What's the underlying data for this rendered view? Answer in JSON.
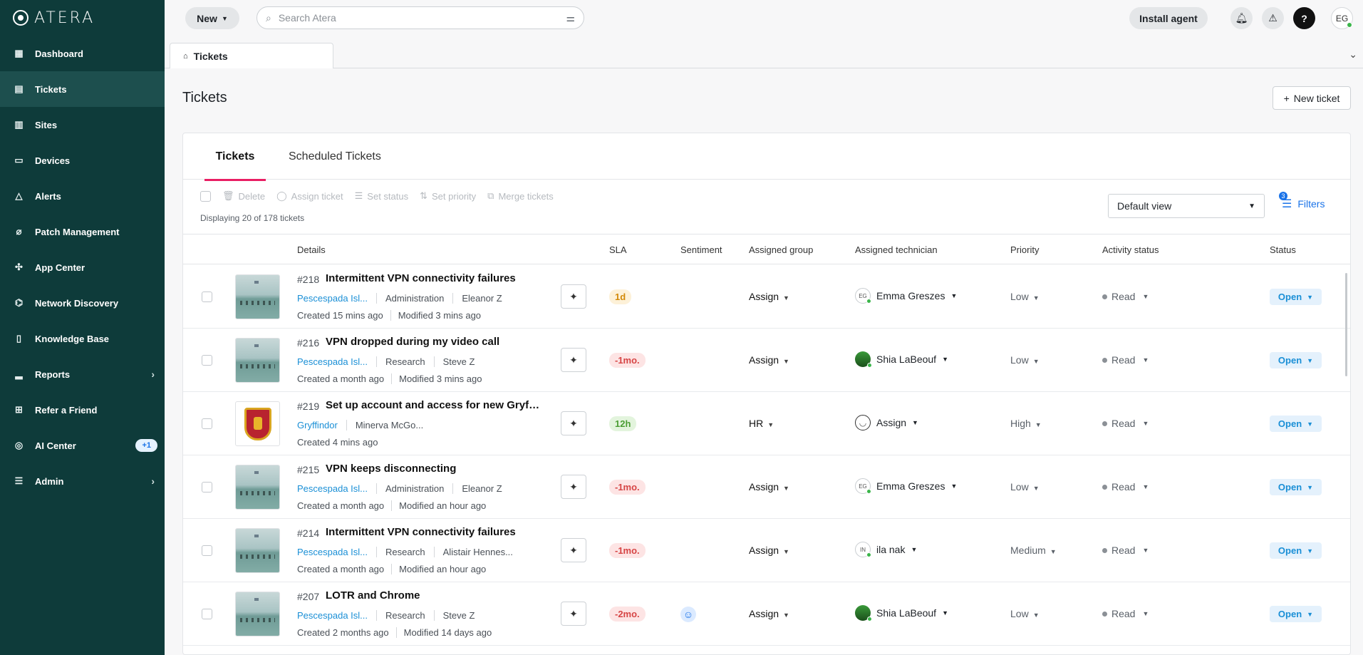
{
  "app": {
    "brand": "ATERA"
  },
  "sidebar": {
    "items": [
      {
        "label": "Dashboard",
        "icon": "dashboard-icon"
      },
      {
        "label": "Tickets",
        "icon": "tickets-icon",
        "active": true
      },
      {
        "label": "Sites",
        "icon": "building-icon"
      },
      {
        "label": "Devices",
        "icon": "monitor-icon"
      },
      {
        "label": "Alerts",
        "icon": "warning-icon"
      },
      {
        "label": "Patch Management",
        "icon": "patch-icon"
      },
      {
        "label": "App Center",
        "icon": "puzzle-icon"
      },
      {
        "label": "Network Discovery",
        "icon": "network-icon"
      },
      {
        "label": "Knowledge Base",
        "icon": "book-icon"
      },
      {
        "label": "Reports",
        "icon": "chart-icon",
        "expandable": true
      },
      {
        "label": "Refer a Friend",
        "icon": "gift-icon"
      },
      {
        "label": "AI Center",
        "icon": "ai-icon",
        "badge": "+1"
      },
      {
        "label": "Admin",
        "icon": "sliders-icon",
        "expandable": true
      }
    ]
  },
  "topbar": {
    "new_label": "New",
    "search_placeholder": "Search Atera",
    "install_label": "Install agent",
    "help_label": "?",
    "user_initials": "EG"
  },
  "breadcrumb_tab": "Tickets",
  "page": {
    "title": "Tickets",
    "new_ticket_label": "New ticket",
    "tabs": [
      "Tickets",
      "Scheduled Tickets"
    ],
    "actions": [
      "Delete",
      "Assign ticket",
      "Set status",
      "Set priority",
      "Merge tickets"
    ],
    "count_text": "Displaying 20 of 178 tickets",
    "view": "Default view",
    "filters_label": "Filters",
    "filters_count": "3"
  },
  "columns": [
    "Details",
    "SLA",
    "Sentiment",
    "Assigned group",
    "Assigned technician",
    "Priority",
    "Activity status",
    "Status"
  ],
  "colors": {
    "sidebar_bg": "#0e3b3a",
    "accent": "#e91e63",
    "link": "#1a8fd6"
  },
  "tickets": [
    {
      "id": "#218",
      "title": "Intermittent VPN connectivity failures",
      "site": "Pescespada Isl...",
      "dept": "Administration",
      "contact": "Eleanor Z",
      "created": "Created 15 mins ago",
      "modified": "Modified 3 mins ago",
      "sla": "1d",
      "sentiment": "",
      "group": "Assign",
      "tech_initials": "EG",
      "tech": "Emma Greszes",
      "priority": "Low",
      "activity": "Read",
      "status": "Open"
    },
    {
      "id": "#216",
      "title": "VPN dropped during my video call",
      "site": "Pescespada Isl...",
      "dept": "Research",
      "contact": "Steve Z",
      "created": "Created a month ago",
      "modified": "Modified 3 mins ago",
      "sla": "-1mo.",
      "sentiment": "",
      "group": "Assign",
      "tech_initials": "",
      "tech": "Shia LaBeouf",
      "priority": "Low",
      "activity": "Read",
      "status": "Open"
    },
    {
      "id": "#219",
      "title": "Set up account and access for new Gryffi...",
      "site": "Gryffindor",
      "dept": "Minerva McGo...",
      "contact": "",
      "created": "Created 4 mins ago",
      "modified": "",
      "sla": "12h",
      "sentiment": "",
      "group": "HR",
      "tech_initials": "",
      "tech": "Assign",
      "priority": "High",
      "activity": "Read",
      "status": "Open"
    },
    {
      "id": "#215",
      "title": "VPN keeps disconnecting",
      "site": "Pescespada Isl...",
      "dept": "Administration",
      "contact": "Eleanor Z",
      "created": "Created a month ago",
      "modified": "Modified an hour ago",
      "sla": "-1mo.",
      "sentiment": "",
      "group": "Assign",
      "tech_initials": "EG",
      "tech": "Emma Greszes",
      "priority": "Low",
      "activity": "Read",
      "status": "Open"
    },
    {
      "id": "#214",
      "title": "Intermittent VPN connectivity failures",
      "site": "Pescespada Isl...",
      "dept": "Research",
      "contact": "Alistair Hennes...",
      "created": "Created a month ago",
      "modified": "Modified an hour ago",
      "sla": "-1mo.",
      "sentiment": "",
      "group": "Assign",
      "tech_initials": "IN",
      "tech": "ila nak",
      "priority": "Medium",
      "activity": "Read",
      "status": "Open"
    },
    {
      "id": "#207",
      "title": "LOTR and Chrome",
      "site": "Pescespada Isl...",
      "dept": "Research",
      "contact": "Steve Z",
      "created": "Created 2 months ago",
      "modified": "Modified 14 days ago",
      "sla": "-2mo.",
      "sentiment": "smiley-icon",
      "group": "Assign",
      "tech_initials": "",
      "tech": "Shia LaBeouf",
      "priority": "Low",
      "activity": "Read",
      "status": "Open"
    }
  ]
}
